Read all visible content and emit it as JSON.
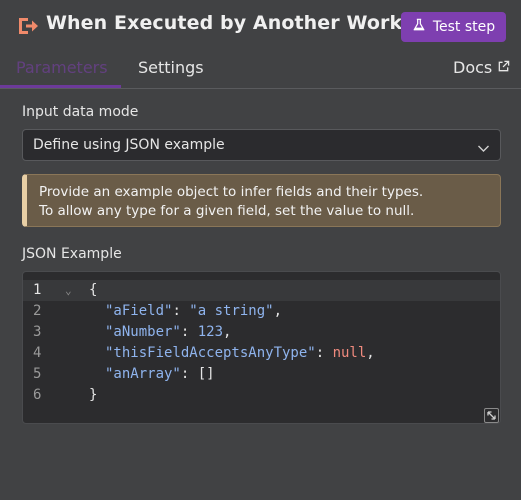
{
  "header": {
    "title": "When Executed by Another Workflow",
    "test_button_label": "Test step",
    "icon": "sign-in-arrow-icon",
    "icon_color": "#f08a6b",
    "accent_color": "#7e3fb0"
  },
  "tabs": [
    {
      "label": "Parameters",
      "active": true
    },
    {
      "label": "Settings",
      "active": false
    },
    {
      "label": "Docs",
      "active": false,
      "icon": "external-link-icon"
    }
  ],
  "input_mode": {
    "label": "Input data mode",
    "value": "Define using JSON example"
  },
  "notice": {
    "line1": "Provide an example object to infer fields and their types.",
    "line2": "To allow any type for a given field, set the value to null."
  },
  "json_example": {
    "label": "JSON Example",
    "lines": [
      {
        "num": "1",
        "text": "{"
      },
      {
        "num": "2",
        "key": "\"aField\"",
        "sep": ": ",
        "value": "\"a string\"",
        "end": ","
      },
      {
        "num": "3",
        "key": "\"aNumber\"",
        "sep": ": ",
        "value": "123",
        "end": ","
      },
      {
        "num": "4",
        "key": "\"thisFieldAcceptsAnyType\"",
        "sep": ": ",
        "value": "null",
        "end": ","
      },
      {
        "num": "5",
        "key": "\"anArray\"",
        "sep": ": ",
        "value": "[]",
        "end": ""
      },
      {
        "num": "6",
        "text": "}"
      }
    ]
  }
}
